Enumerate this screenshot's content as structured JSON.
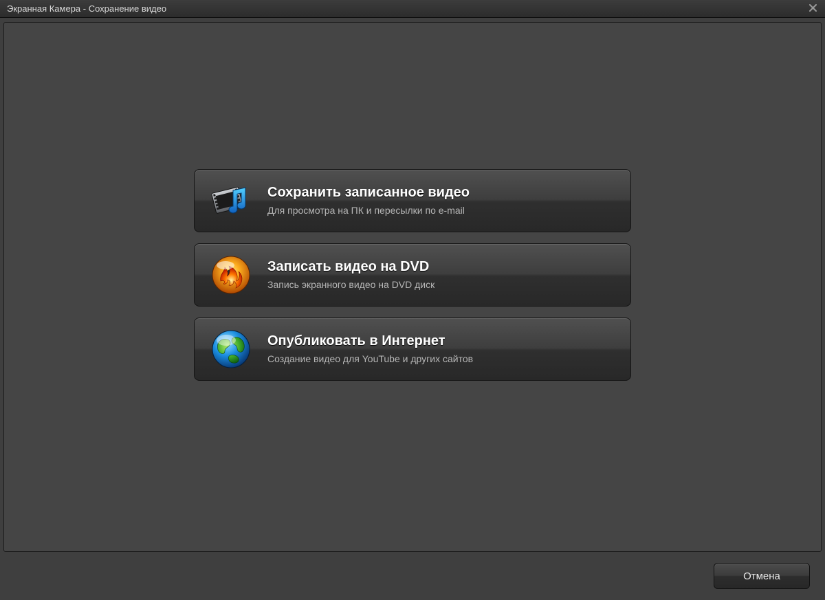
{
  "window": {
    "title": "Экранная Камера - Сохранение видео",
    "close_icon": "close-icon"
  },
  "options": [
    {
      "id": "save-video",
      "icon": "film-music-icon",
      "title": "Сохранить записанное видео",
      "description": "Для просмотра на ПК и пересылки по e-mail"
    },
    {
      "id": "burn-dvd",
      "icon": "dvd-burn-icon",
      "title": "Записать видео на DVD",
      "description": "Запись экранного видео на DVD диск"
    },
    {
      "id": "publish-web",
      "icon": "globe-icon",
      "title": "Опубликовать в Интернет",
      "description": "Создание видео для YouTube и других сайтов"
    }
  ],
  "footer": {
    "cancel_label": "Отмена"
  }
}
